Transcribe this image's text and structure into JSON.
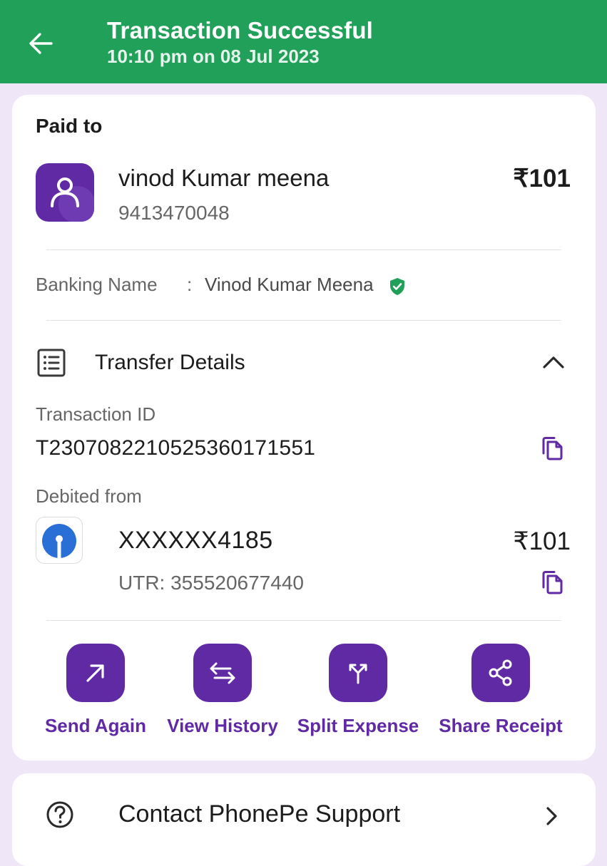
{
  "header": {
    "title": "Transaction Successful",
    "subtitle": "10:10 pm on 08 Jul 2023"
  },
  "paid_to": {
    "title": "Paid to",
    "name": "vinod Kumar meena",
    "phone": "9413470048",
    "amount": "₹101",
    "banking_name_label": "Banking Name",
    "separator": ":",
    "banking_name_value": "Vinod Kumar Meena"
  },
  "transfer_details": {
    "title": "Transfer Details",
    "transaction_id_label": "Transaction ID",
    "transaction_id": "T2307082210525360171551",
    "debited_from_label": "Debited from",
    "account_number": "XXXXXX4185",
    "utr": "UTR: 355520677440",
    "amount": "₹101"
  },
  "actions": [
    {
      "label": "Send Again",
      "icon": "arrow-up-right-icon"
    },
    {
      "label": "View History",
      "icon": "swap-arrows-icon"
    },
    {
      "label": "Split Expense",
      "icon": "split-icon"
    },
    {
      "label": "Share Receipt",
      "icon": "share-icon"
    }
  ],
  "support": {
    "label": "Contact PhonePe Support"
  },
  "colors": {
    "header_green": "#21a05a",
    "brand_purple": "#5f2aa3",
    "background": "#efe6f7",
    "verified_green": "#21a05a",
    "sbi_blue": "#2a6fd6"
  }
}
